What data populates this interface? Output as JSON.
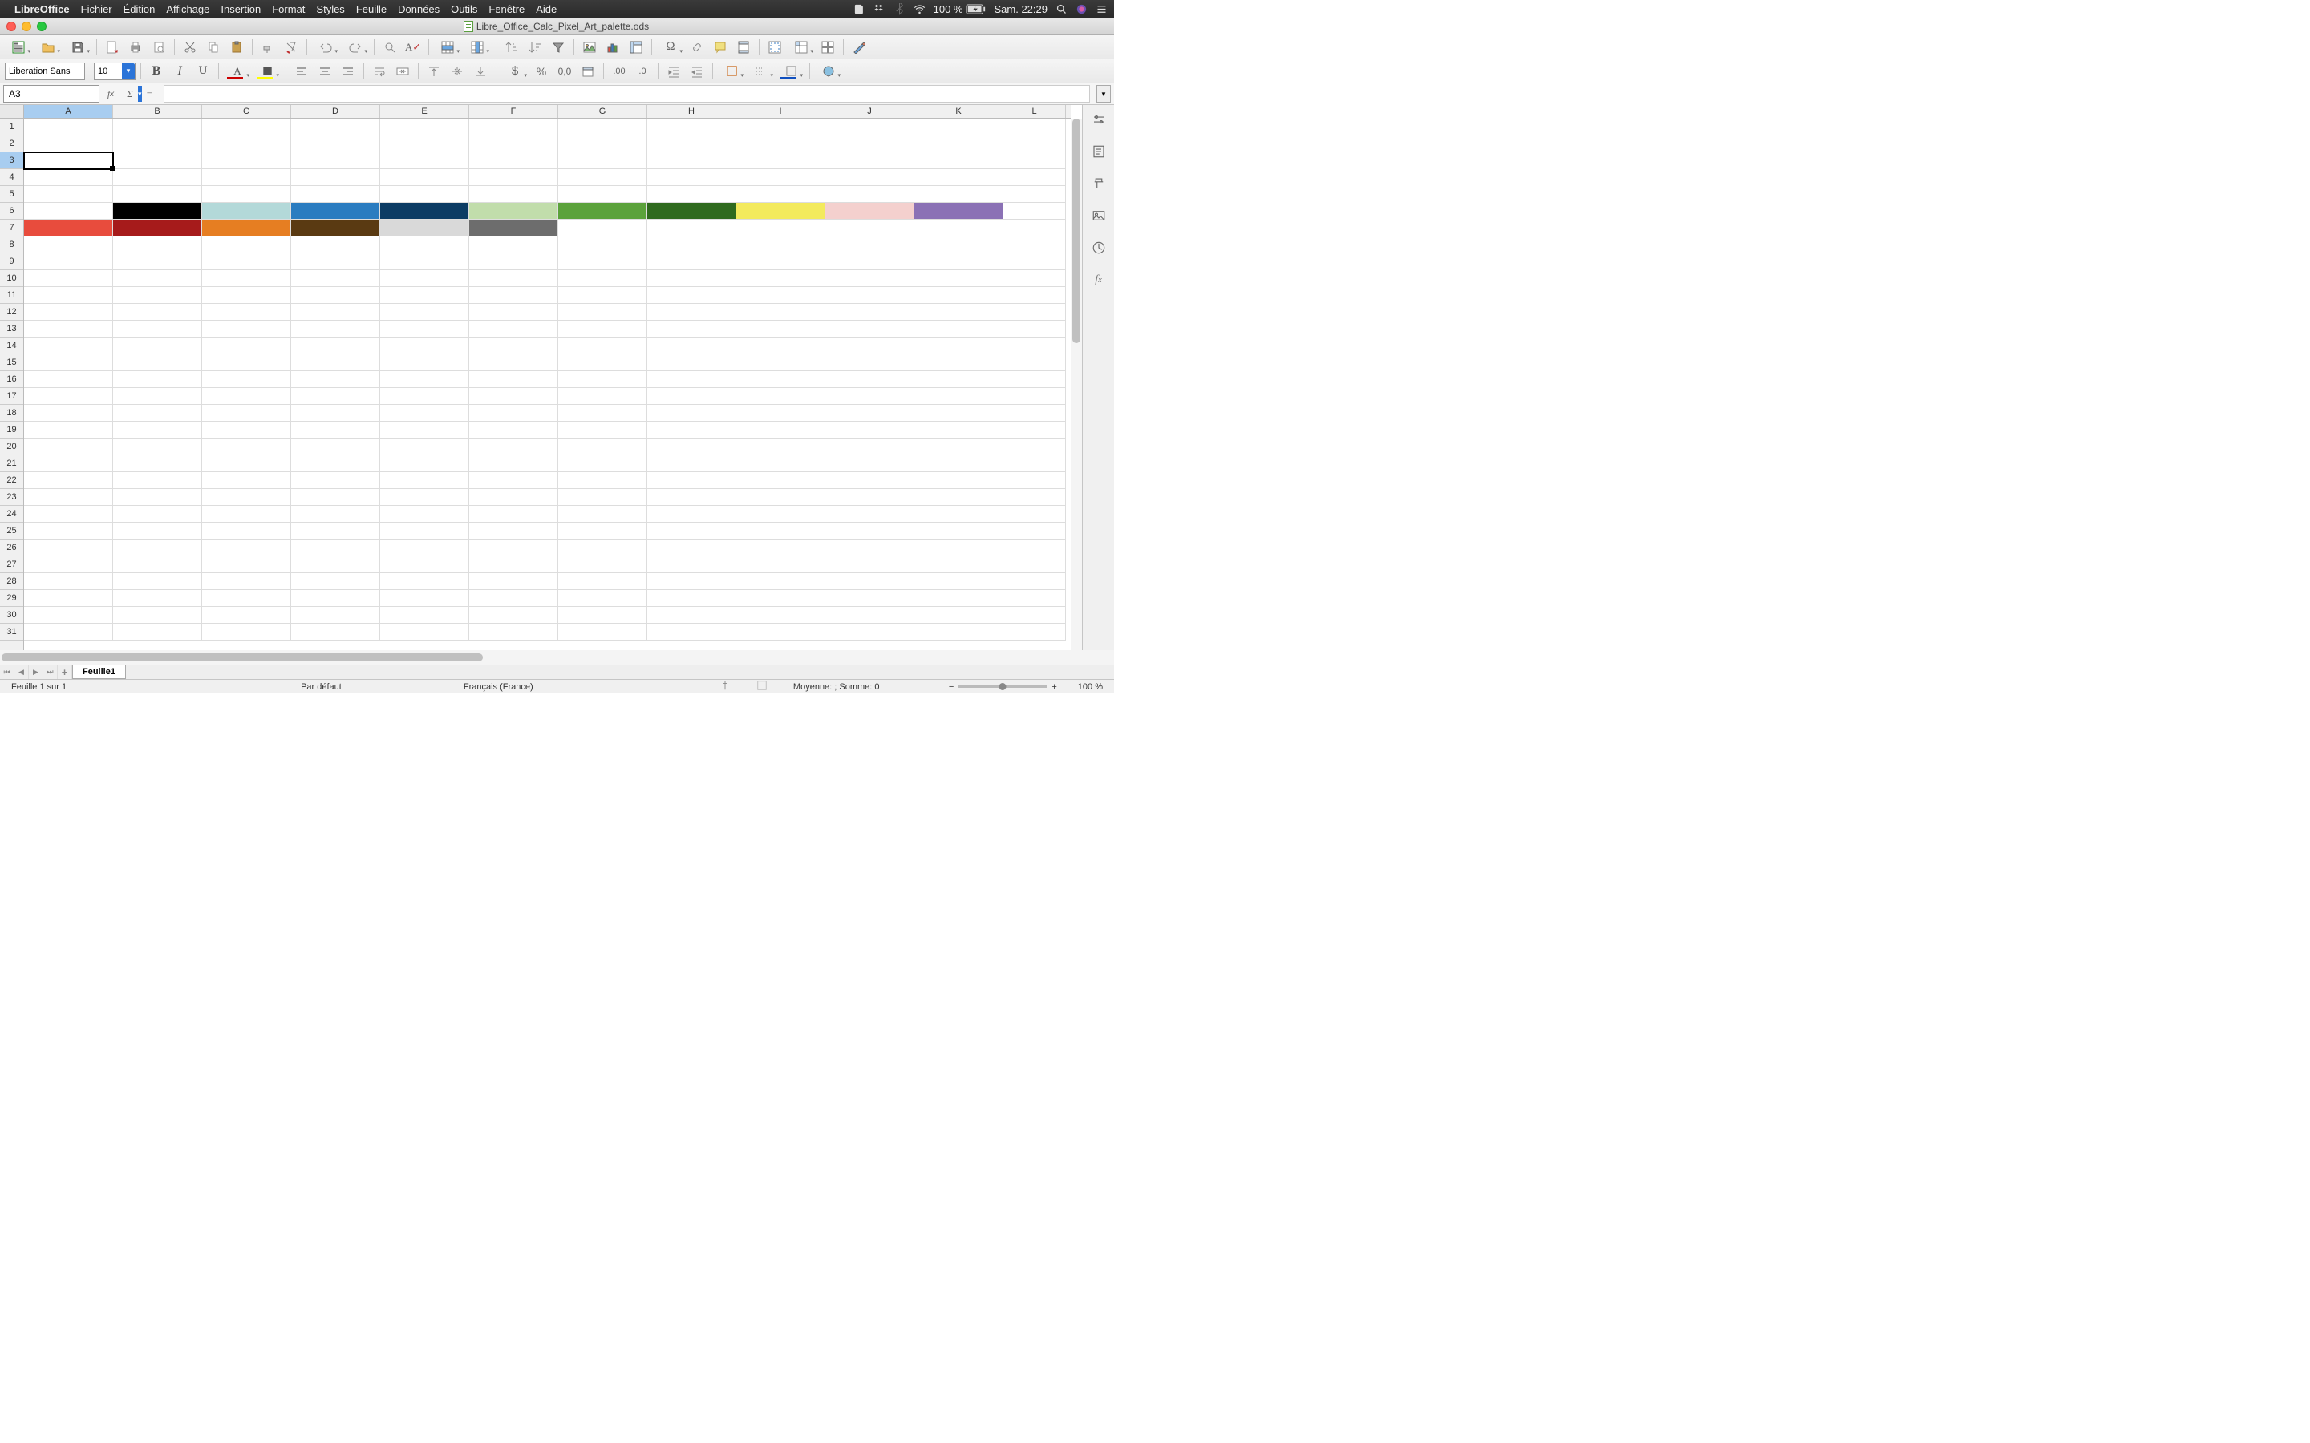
{
  "macos": {
    "app_name": "LibreOffice",
    "menus": [
      "Fichier",
      "Édition",
      "Affichage",
      "Insertion",
      "Format",
      "Styles",
      "Feuille",
      "Données",
      "Outils",
      "Fenêtre",
      "Aide"
    ],
    "battery": "100 %",
    "datetime": "Sam. 22:29"
  },
  "window": {
    "title": "Libre_Office_Calc_Pixel_Art_palette.ods"
  },
  "toolbar": {},
  "format_bar": {
    "font_name": "Liberation Sans",
    "font_size": "10"
  },
  "namebox": {
    "cell_ref": "A3"
  },
  "grid": {
    "columns": [
      {
        "label": "A",
        "width": 111
      },
      {
        "label": "B",
        "width": 111
      },
      {
        "label": "C",
        "width": 111
      },
      {
        "label": "D",
        "width": 111
      },
      {
        "label": "E",
        "width": 111
      },
      {
        "label": "F",
        "width": 111
      },
      {
        "label": "G",
        "width": 111
      },
      {
        "label": "H",
        "width": 111
      },
      {
        "label": "I",
        "width": 111
      },
      {
        "label": "J",
        "width": 111
      },
      {
        "label": "K",
        "width": 111
      },
      {
        "label": "L",
        "width": 78
      }
    ],
    "rows": 31,
    "selected_cell": {
      "row": 3,
      "col": "A"
    },
    "palette_rows": {
      "6": [
        "",
        "#000000",
        "#b3d9d9",
        "#2a7cc0",
        "#0c3c64",
        "#c1ddab",
        "#5ba23b",
        "#2f6a1e",
        "#f3ea5d",
        "#f4d0ce",
        "#8b71b5",
        ""
      ],
      "7": [
        "#e84c3d",
        "#a61b1b",
        "#e67e22",
        "#5a3a12",
        "#d9d9d9",
        "#6d6d6d",
        "",
        "",
        "",
        "",
        "",
        ""
      ]
    }
  },
  "sheet_tabs": {
    "active": "Feuille1"
  },
  "status": {
    "sheet_info": "Feuille 1 sur 1",
    "page_style": "Par défaut",
    "locale": "Français (France)",
    "summary": "Moyenne: ; Somme: 0",
    "zoom": "100 %"
  },
  "icons": {
    "apple": "",
    "evernote": "ev",
    "dropbox": "db",
    "bluetooth": "bt",
    "wifi": "wf",
    "spotlight": "sp",
    "notif": "nt",
    "siri": "sr",
    "battery": "bat"
  }
}
